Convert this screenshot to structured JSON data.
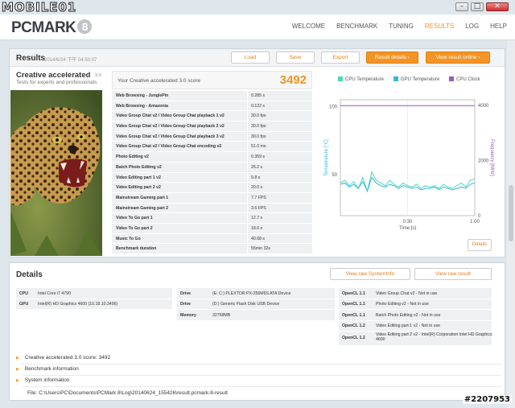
{
  "window": {
    "watermark": "MOBILE01",
    "controls": [
      "–",
      "□",
      "✕"
    ]
  },
  "app": {
    "logo_text": "PCMARK",
    "logo_version": "8",
    "nav": [
      {
        "label": "WELCOME",
        "active": false
      },
      {
        "label": "BENCHMARK",
        "active": false
      },
      {
        "label": "TUNING",
        "active": false
      },
      {
        "label": "RESULTS",
        "active": true
      },
      {
        "label": "LOG",
        "active": false
      },
      {
        "label": "HELP",
        "active": false
      }
    ]
  },
  "results": {
    "title": "Results",
    "date": "2014/6/24 下午 04:50:07",
    "buttons": {
      "load": "Load",
      "save": "Save",
      "export": "Export",
      "details": "Result details ›",
      "online": "View result online ›"
    },
    "test_name": "Creative accelerated",
    "test_version": "3.0",
    "test_subtitle": "Tests for experts and professionals",
    "score_label": "Your Creative accelerated 3.0 score",
    "score": "3492",
    "rows": [
      {
        "name": "Web Browsing - JunglePin",
        "value": "0.285 s"
      },
      {
        "name": "Web Browsing - Amazonia",
        "value": "0.122 s"
      },
      {
        "name": "Video Group Chat v2 / Video Group Chat playback 1 v2",
        "value": "30.0 fps"
      },
      {
        "name": "Video Group Chat v2 / Video Group Chat playback 2 v2",
        "value": "30.0 fps"
      },
      {
        "name": "Video Group Chat v2 / Video Group Chat playback 3 v2",
        "value": "30.0 fps"
      },
      {
        "name": "Video Group Chat v2 / Video Group Chat encoding v2",
        "value": "51.0 ms"
      },
      {
        "name": "Photo Editing v2",
        "value": "0.359 s"
      },
      {
        "name": "Batch Photo Editing v2",
        "value": "26.2 s"
      },
      {
        "name": "Video Editing part 1 v2",
        "value": "9.8 s"
      },
      {
        "name": "Video Editing part 2 v2",
        "value": "20.0 s"
      },
      {
        "name": "Mainstream Gaming part 1",
        "value": "7.7 FPS"
      },
      {
        "name": "Mainstream Gaming part 2",
        "value": "3.6 FPS"
      },
      {
        "name": "Video To Go part 1",
        "value": "12.7 s"
      },
      {
        "name": "Video To Go part 2",
        "value": "18.6 s"
      },
      {
        "name": "Music To Go",
        "value": "40.68 s"
      },
      {
        "name": "Benchmark duration",
        "value": "55min 32s"
      }
    ],
    "details_button": "Details"
  },
  "chart_data": {
    "type": "line",
    "legend": [
      {
        "name": "CPU Temperature",
        "color": "#4dd9b8"
      },
      {
        "name": "GPU Temperature",
        "color": "#3ab6d8"
      },
      {
        "name": "CPU Clock",
        "color": "#9b59c6"
      }
    ],
    "xlabel": "Time [s]",
    "ylabel": "Temperature [°C]",
    "y2label": "Frequency [MHz]",
    "x_ticks": [
      "0:30",
      "1:00"
    ],
    "y_ticks": [
      "100",
      "50"
    ],
    "y2_ticks": [
      "4000",
      "2000",
      "0"
    ],
    "ylim": [
      20,
      105
    ],
    "y2lim": [
      0,
      4200
    ],
    "xlim": [
      0,
      60
    ],
    "series": [
      {
        "name": "CPU Temperature",
        "x": [
          0,
          2,
          4,
          6,
          8,
          10,
          12,
          14,
          16,
          18,
          20,
          22,
          24,
          26,
          28,
          30,
          32,
          34,
          36,
          38,
          40,
          42,
          44,
          46,
          48,
          50,
          52,
          54,
          56,
          58,
          60
        ],
        "values": [
          44,
          46,
          42,
          45,
          40,
          48,
          38,
          52,
          46,
          44,
          42,
          46,
          43,
          41,
          44,
          42,
          41,
          43,
          40,
          42,
          41,
          42,
          40,
          43,
          41,
          40,
          42,
          44,
          41,
          46,
          47
        ]
      },
      {
        "name": "GPU Temperature",
        "x": [
          0,
          2,
          4,
          6,
          8,
          10,
          12,
          14,
          16,
          18,
          20,
          22,
          24,
          26,
          28,
          30,
          32,
          34,
          36,
          38,
          40,
          42,
          44,
          46,
          48,
          50,
          52,
          54,
          56,
          58,
          60
        ],
        "values": [
          43,
          44,
          41,
          43,
          40,
          45,
          38,
          48,
          44,
          42,
          41,
          43,
          42,
          40,
          42,
          41,
          40,
          41,
          39,
          40,
          40,
          41,
          39,
          41,
          40,
          39,
          40,
          41,
          40,
          43,
          44
        ]
      },
      {
        "name": "CPU Clock",
        "x": [
          0,
          60
        ],
        "values": [
          3990,
          3990
        ]
      }
    ]
  },
  "details": {
    "title": "Details",
    "btn_system": "View raw SystemInfo",
    "btn_result": "View raw result",
    "hw": [
      {
        "key": "CPU",
        "value": "Intel Core i7 4790"
      },
      {
        "key": "GPU",
        "value": "Intel(R) HD Graphics 4600 (10.18.10.3496)"
      }
    ],
    "drives": [
      {
        "key": "Drive",
        "value": "(E: C:) PLEXTOR PX-256M6S ATA Device"
      },
      {
        "key": "Drive",
        "value": "(D:) Generic Flash Disk USB Device"
      },
      {
        "key": "Memory",
        "value": "32768MB"
      }
    ],
    "opencl": [
      {
        "key": "OpenCL 1.1",
        "value": "Video Group Chat v2 - Not in use"
      },
      {
        "key": "OpenCL 1.1",
        "value": "Photo Editing v2 - Not in use"
      },
      {
        "key": "OpenCL 1.1",
        "value": "Batch Photo Editing v2 - Not in use"
      },
      {
        "key": "OpenCL 1.2",
        "value": "Video Editing part 1 v2 - Not in use"
      },
      {
        "key": "OpenCL 1.2",
        "value": "Video Editing part 2 v2 - Intel(R) Corporation Intel HD Graphics 4600"
      }
    ],
    "expanders": [
      "Creative accelerated 3.0 score: 3492",
      "Benchmark information",
      "System information"
    ],
    "file": "File: C:\\Users\\PC\\Documents\\PCMark 8\\Log\\20140624_155426\\result.pcmark-8-result"
  },
  "corner_tag": "#2207953"
}
